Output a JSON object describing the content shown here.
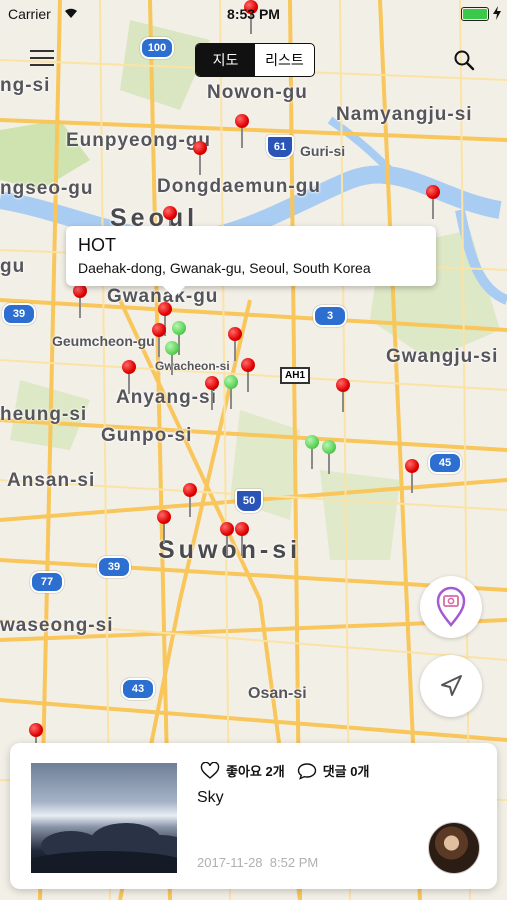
{
  "status_bar": {
    "carrier": "Carrier",
    "time": "8:53 PM"
  },
  "toolbar": {
    "segments": [
      "지도",
      "리스트"
    ],
    "active_segment": "지도"
  },
  "map": {
    "cities": [
      {
        "name": "ng-si"
      },
      {
        "name": "Nowon-gu"
      },
      {
        "name": "Eunpyeong-gu"
      },
      {
        "name": "Namyangju-si"
      },
      {
        "name": "Guri-si"
      },
      {
        "name": "ngseo-gu"
      },
      {
        "name": "Dongdaemun-gu"
      },
      {
        "name": "Seoul"
      },
      {
        "name": "gu"
      },
      {
        "name": "Gwanak-gu"
      },
      {
        "name": "Geumcheon-gu"
      },
      {
        "name": "Gwacheon-si"
      },
      {
        "name": "Gwangju-si"
      },
      {
        "name": "Anyang-si"
      },
      {
        "name": "heung-si"
      },
      {
        "name": "Gunpo-si"
      },
      {
        "name": "Ansan-si"
      },
      {
        "name": "Suwon-si"
      },
      {
        "name": "waseong-si"
      },
      {
        "name": "Osan-si"
      }
    ],
    "route_shields": [
      "100",
      "61",
      "39",
      "3",
      "45",
      "50",
      "39",
      "77",
      "43"
    ],
    "asian_highway": "AH1"
  },
  "callout": {
    "title": "HOT",
    "subtitle": "Daehak-dong, Gwanak-gu, Seoul, South Korea"
  },
  "post_card": {
    "likes_label": "좋아요 2개",
    "comments_label": "댓글 0개",
    "title": "Sky",
    "date": "2017-11-28",
    "time": "8:52 PM"
  },
  "colors": {
    "pin_red": "#e00000",
    "pin_green": "#5dd35a",
    "accent_purple": "#a45bd1"
  }
}
